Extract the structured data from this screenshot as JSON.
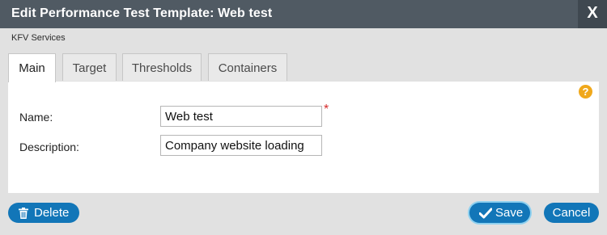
{
  "dialog": {
    "title": "Edit Performance Test Template: Web test",
    "close_label": "X",
    "breadcrumb": "KFV Services"
  },
  "tabs": [
    {
      "label": "Main",
      "active": true
    },
    {
      "label": "Target",
      "active": false
    },
    {
      "label": "Thresholds",
      "active": false
    },
    {
      "label": "Containers",
      "active": false
    }
  ],
  "form": {
    "help_label": "?",
    "name_label": "Name:",
    "name_value": "Web test",
    "required_mark": "*",
    "description_label": "Description:",
    "description_value": "Company website loading"
  },
  "footer": {
    "delete_label": "Delete",
    "save_label": "Save",
    "cancel_label": "Cancel"
  },
  "icons": {
    "delete": "trash-icon",
    "save": "checkmark-icon",
    "help": "question-icon",
    "close": "close-icon"
  },
  "colors": {
    "title_bar": "#505a63",
    "button": "#1276b8",
    "help": "#f0a81b",
    "required": "#d52b2b"
  }
}
